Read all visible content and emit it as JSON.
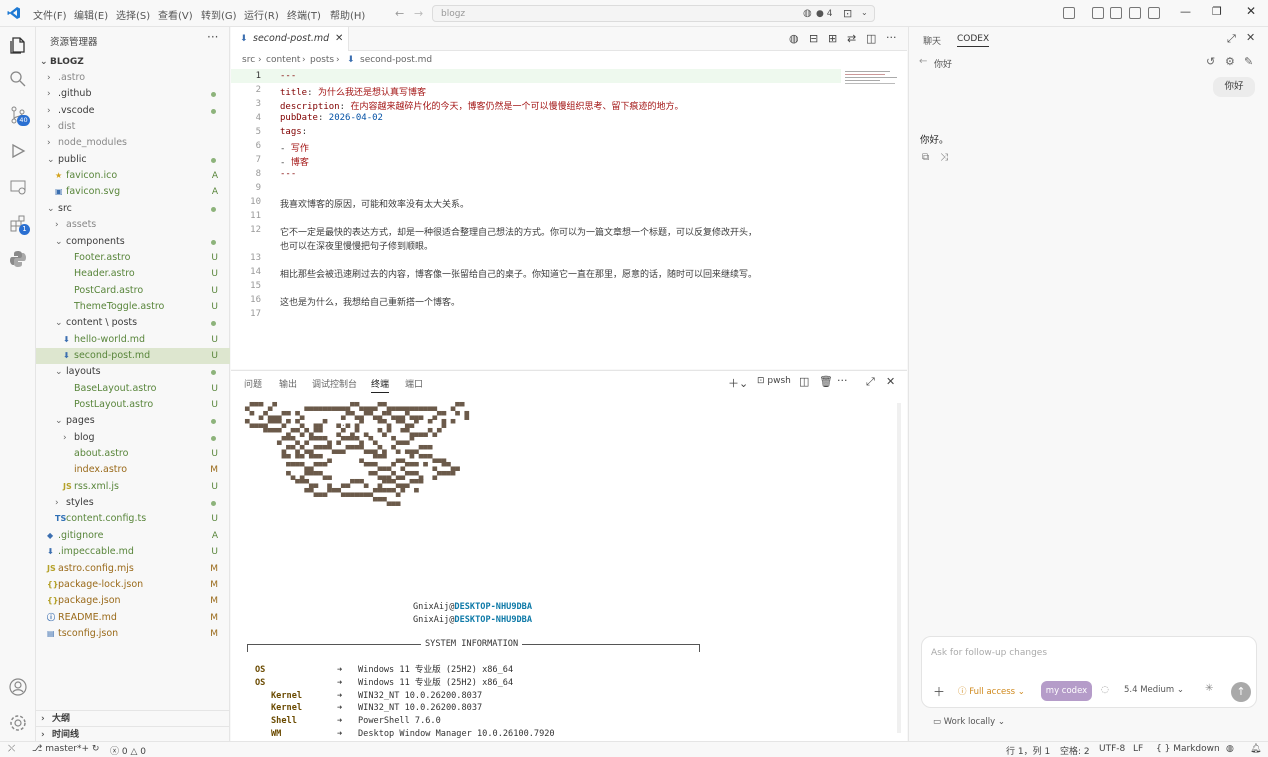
{
  "menu": [
    "文件(F)",
    "编辑(E)",
    "选择(S)",
    "查看(V)",
    "转到(G)",
    "运行(R)",
    "终端(T)",
    "帮助(H)"
  ],
  "search_text": "blogz",
  "badge_count": "4",
  "sidebar": {
    "title": "资源管理器",
    "root": "BLOGZ",
    "items": [
      {
        "label": ".astro",
        "depth": 1,
        "kind": "folder",
        "status": ""
      },
      {
        "label": ".github",
        "depth": 1,
        "kind": "folder",
        "status": "dot"
      },
      {
        "label": ".vscode",
        "depth": 1,
        "kind": "folder",
        "status": "dot"
      },
      {
        "label": "dist",
        "depth": 1,
        "kind": "folder",
        "status": ""
      },
      {
        "label": "node_modules",
        "depth": 1,
        "kind": "folder",
        "status": ""
      },
      {
        "label": "public",
        "depth": 1,
        "kind": "folder-open",
        "status": "dot"
      },
      {
        "label": "favicon.ico",
        "depth": 2,
        "kind": "file",
        "icon": "★",
        "status": "A"
      },
      {
        "label": "favicon.svg",
        "depth": 2,
        "kind": "file",
        "icon": "▣",
        "status": "A"
      },
      {
        "label": "src",
        "depth": 1,
        "kind": "folder-open",
        "status": "dot"
      },
      {
        "label": "assets",
        "depth": 2,
        "kind": "folder",
        "status": ""
      },
      {
        "label": "components",
        "depth": 2,
        "kind": "folder-open",
        "status": "dot"
      },
      {
        "label": "Footer.astro",
        "depth": 3,
        "kind": "file",
        "icon": "",
        "status": "U"
      },
      {
        "label": "Header.astro",
        "depth": 3,
        "kind": "file",
        "icon": "",
        "status": "U"
      },
      {
        "label": "PostCard.astro",
        "depth": 3,
        "kind": "file",
        "icon": "",
        "status": "U"
      },
      {
        "label": "ThemeToggle.astro",
        "depth": 3,
        "kind": "file",
        "icon": "",
        "status": "U"
      },
      {
        "label": "content \\ posts",
        "depth": 2,
        "kind": "folder-open",
        "status": "dot"
      },
      {
        "label": "hello-world.md",
        "depth": 3,
        "kind": "file",
        "icon": "⬇",
        "status": "U"
      },
      {
        "label": "second-post.md",
        "depth": 3,
        "kind": "file",
        "icon": "⬇",
        "status": "U",
        "selected": true
      },
      {
        "label": "layouts",
        "depth": 2,
        "kind": "folder-open",
        "status": "dot"
      },
      {
        "label": "BaseLayout.astro",
        "depth": 3,
        "kind": "file",
        "icon": "",
        "status": "U"
      },
      {
        "label": "PostLayout.astro",
        "depth": 3,
        "kind": "file",
        "icon": "",
        "status": "U"
      },
      {
        "label": "pages",
        "depth": 2,
        "kind": "folder-open",
        "status": "dot"
      },
      {
        "label": "blog",
        "depth": 3,
        "kind": "folder",
        "status": "dot"
      },
      {
        "label": "about.astro",
        "depth": 3,
        "kind": "file",
        "icon": "",
        "status": "U"
      },
      {
        "label": "index.astro",
        "depth": 3,
        "kind": "file",
        "icon": "",
        "status": "M"
      },
      {
        "label": "rss.xml.js",
        "depth": 3,
        "kind": "file",
        "icon": "JS",
        "status": "U"
      },
      {
        "label": "styles",
        "depth": 2,
        "kind": "folder",
        "status": "dot"
      },
      {
        "label": "content.config.ts",
        "depth": 2,
        "kind": "file",
        "icon": "TS",
        "status": "U"
      },
      {
        "label": ".gitignore",
        "depth": 1,
        "kind": "file",
        "icon": "◆",
        "status": "A"
      },
      {
        "label": ".impeccable.md",
        "depth": 1,
        "kind": "file",
        "icon": "⬇",
        "status": "U"
      },
      {
        "label": "astro.config.mjs",
        "depth": 1,
        "kind": "file",
        "icon": "JS",
        "status": "M"
      },
      {
        "label": "package-lock.json",
        "depth": 1,
        "kind": "file",
        "icon": "{}",
        "status": "M"
      },
      {
        "label": "package.json",
        "depth": 1,
        "kind": "file",
        "icon": "{}",
        "status": "M"
      },
      {
        "label": "README.md",
        "depth": 1,
        "kind": "file",
        "icon": "ⓘ",
        "status": "M"
      },
      {
        "label": "tsconfig.json",
        "depth": 1,
        "kind": "file",
        "icon": "▤",
        "status": "M"
      }
    ],
    "outline": "大纲",
    "timeline": "时间线"
  },
  "editor": {
    "tab_label": "second-post.md",
    "breadcrumb": [
      "src",
      "content",
      "posts",
      "second-post.md"
    ],
    "lines": [
      {
        "n": "1",
        "html": "<span class='k'>---</span>"
      },
      {
        "n": "2",
        "html": "<span class='k'>title</span>: <span class='s'>为什么我还是想认真写博客</span>"
      },
      {
        "n": "3",
        "html": "<span class='k'>description</span>: <span class='s'>在内容越来越碎片化的今天，博客仍然是一个可以慢慢组织思考、留下痕迹的地方。</span>"
      },
      {
        "n": "4",
        "html": "<span class='k'>pubDate</span>: <span class='p'>2026-04-02</span>"
      },
      {
        "n": "5",
        "html": "<span class='k'>tags</span>:"
      },
      {
        "n": "6",
        "html": "  - <span class='s'>写作</span>"
      },
      {
        "n": "7",
        "html": "  - <span class='s'>博客</span>"
      },
      {
        "n": "8",
        "html": "<span class='k'>---</span>"
      },
      {
        "n": "9",
        "html": ""
      },
      {
        "n": "10",
        "html": "我喜欢博客的原因，可能和效率没有太大关系。"
      },
      {
        "n": "11",
        "html": ""
      },
      {
        "n": "12",
        "html": "它不一定是最快的表达方式，却是一种很适合整理自己想法的方式。你可以为一篇文章想一个标题，可以反复修改开头，"
      },
      {
        "n": "",
        "html": "也可以在深夜里慢慢把句子修到顺眼。"
      },
      {
        "n": "13",
        "html": ""
      },
      {
        "n": "14",
        "html": "相比那些会被迅速刷过去的内容，博客像一张留给自己的桌子。你知道它一直在那里，愿意的话，随时可以回来继续写。"
      },
      {
        "n": "15",
        "html": ""
      },
      {
        "n": "16",
        "html": "这也是为什么，我想给自己重新搭一个博客。"
      },
      {
        "n": "17",
        "html": ""
      }
    ]
  },
  "panel": {
    "tabs": [
      "问题",
      "输出",
      "调试控制台",
      "终端",
      "端口"
    ],
    "shell": "pwsh",
    "user": "GnixAij",
    "host": "DESKTOP-NHU9DBA",
    "sysinfo_title": "SYSTEM INFORMATION",
    "rows": [
      {
        "key": "OS",
        "val": "Windows 11 专业版 (25H2) x86_64"
      },
      {
        "key": "OS",
        "val": "Windows 11 专业版 (25H2) x86_64"
      },
      {
        "key": "Kernel",
        "val": "WIN32_NT 10.0.26200.8037"
      },
      {
        "key": "Kernel",
        "val": "WIN32_NT 10.0.26200.8037"
      },
      {
        "key": "Shell",
        "val": "PowerShell 7.6.0"
      },
      {
        "key": "WM",
        "val": "Desktop Window Manager 10.0.26100.7920"
      }
    ]
  },
  "chat": {
    "tab_chat": "聊天",
    "tab_codex": "CODEX",
    "thread_title": "你好",
    "user_msg": "你好",
    "assistant_msg": "你好。",
    "input_placeholder": "Ask for follow-up changes",
    "access": "Full access",
    "codex_label": "my codex",
    "model": "5.4  Medium",
    "work_locally": "Work locally"
  },
  "status": {
    "branch": "master*+",
    "errors": "0",
    "warnings": "0",
    "position": "行 1，列 1",
    "spaces": "空格: 2",
    "encoding": "UTF-8",
    "eol": "LF",
    "lang": "Markdown"
  }
}
